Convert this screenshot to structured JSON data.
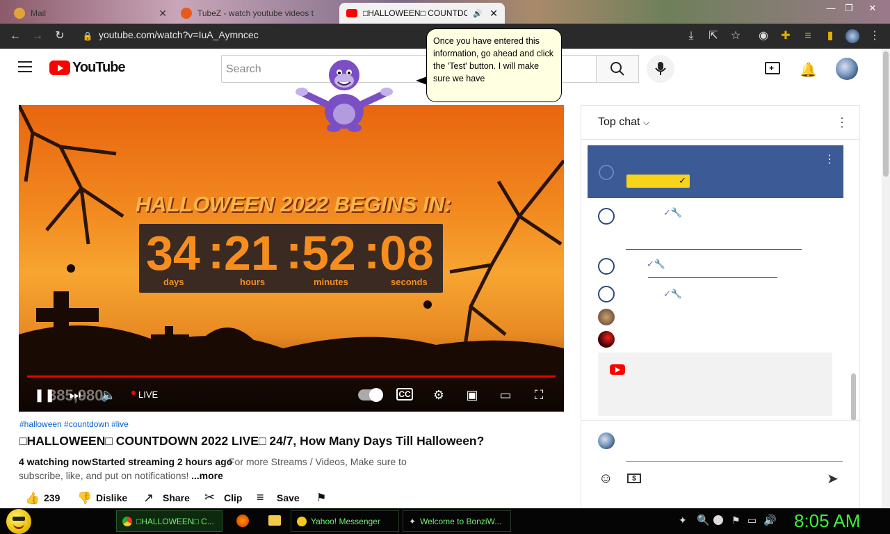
{
  "browser": {
    "tabs": [
      {
        "title": "Mail",
        "active": false
      },
      {
        "title": "TubeZ - watch youtube videos t",
        "active": false
      },
      {
        "title": "□HALLOWEEN□ COUNTDOWN",
        "active": true
      }
    ],
    "url": "youtube.com/watch?v=IuA_Aymncec"
  },
  "youtube": {
    "logo_text": "YouTube",
    "search_placeholder": "Search"
  },
  "bonzi": {
    "speech": "Once you have entered this information, go ahead and click the 'Test' button. I will make sure we have"
  },
  "video": {
    "title_banner": "HALLOWEEN 2022 BEGINS IN:",
    "countdown": [
      {
        "value": "34",
        "unit": "days"
      },
      {
        "value": "21",
        "unit": "hours"
      },
      {
        "value": "52",
        "unit": "minutes"
      },
      {
        "value": "08",
        "unit": "seconds"
      }
    ],
    "live_label": "LIVE",
    "overlay_views": "385,980"
  },
  "chat": {
    "header": "Top chat",
    "banner_check": "✓"
  },
  "details": {
    "hashtags": "#halloween #countdown #live",
    "title": "□HALLOWEEN□ COUNTDOWN 2022 LIVE□ 24/7, How Many Days Till Halloween?",
    "watching": "4 watching now",
    "started": "Started streaming 2 hours ago",
    "description_line1": "For more Streams / Videos, Make sure to",
    "description_line2": "subscribe, like, and put on notifications!",
    "more": "...more",
    "likes": "239",
    "dislike": "Dislike",
    "share": "Share",
    "clip": "Clip",
    "save": "Save"
  },
  "taskbar": {
    "items": [
      {
        "label": "□HALLOWEEN□ C..."
      },
      {
        "label": "Yahoo! Messenger"
      },
      {
        "label": "Welcome to BonziW..."
      }
    ],
    "clock": "8:05 AM"
  },
  "colors": {
    "accent_red": "#ff0000",
    "taskbar_green": "#6ff26f",
    "chat_banner": "#3c5a95"
  }
}
